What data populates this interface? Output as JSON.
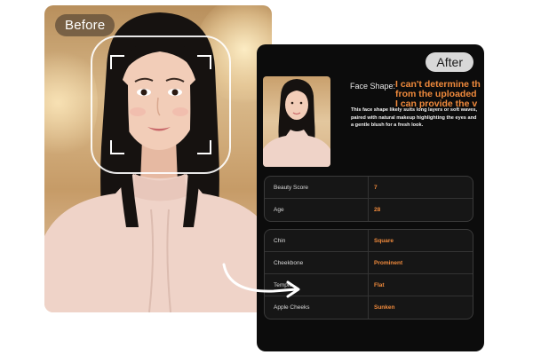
{
  "before": {
    "label": "Before"
  },
  "after": {
    "label": "After",
    "face_shape": {
      "label": "Face Shape:",
      "value": "I can't determine the face shape from the uploaded image, but I can provide the ...",
      "line1": "I can't determine th",
      "line2": "from the uploaded",
      "line3": "I can provide the v"
    },
    "description": "This face shape likely suits long layers or soft waves, paired with natural makeup highlighting the eyes and a gentle blush for a fresh look.",
    "scores": [
      {
        "label": "Beauty Score",
        "value": "7"
      },
      {
        "label": "Age",
        "value": "28"
      }
    ],
    "features": [
      {
        "label": "Chin",
        "value": "Square"
      },
      {
        "label": "Cheekbone",
        "value": "Prominent"
      },
      {
        "label": "Temple",
        "value": "Flat"
      },
      {
        "label": "Apple Cheeks",
        "value": "Sunken"
      }
    ]
  },
  "colors": {
    "accent": "#f08a3c",
    "card_dark": "#0c0c0c",
    "badge_light": "#d8d8d8"
  },
  "icons": {
    "arrow": "curved-arrow-icon",
    "scan_frame": "face-scan-frame-icon"
  }
}
